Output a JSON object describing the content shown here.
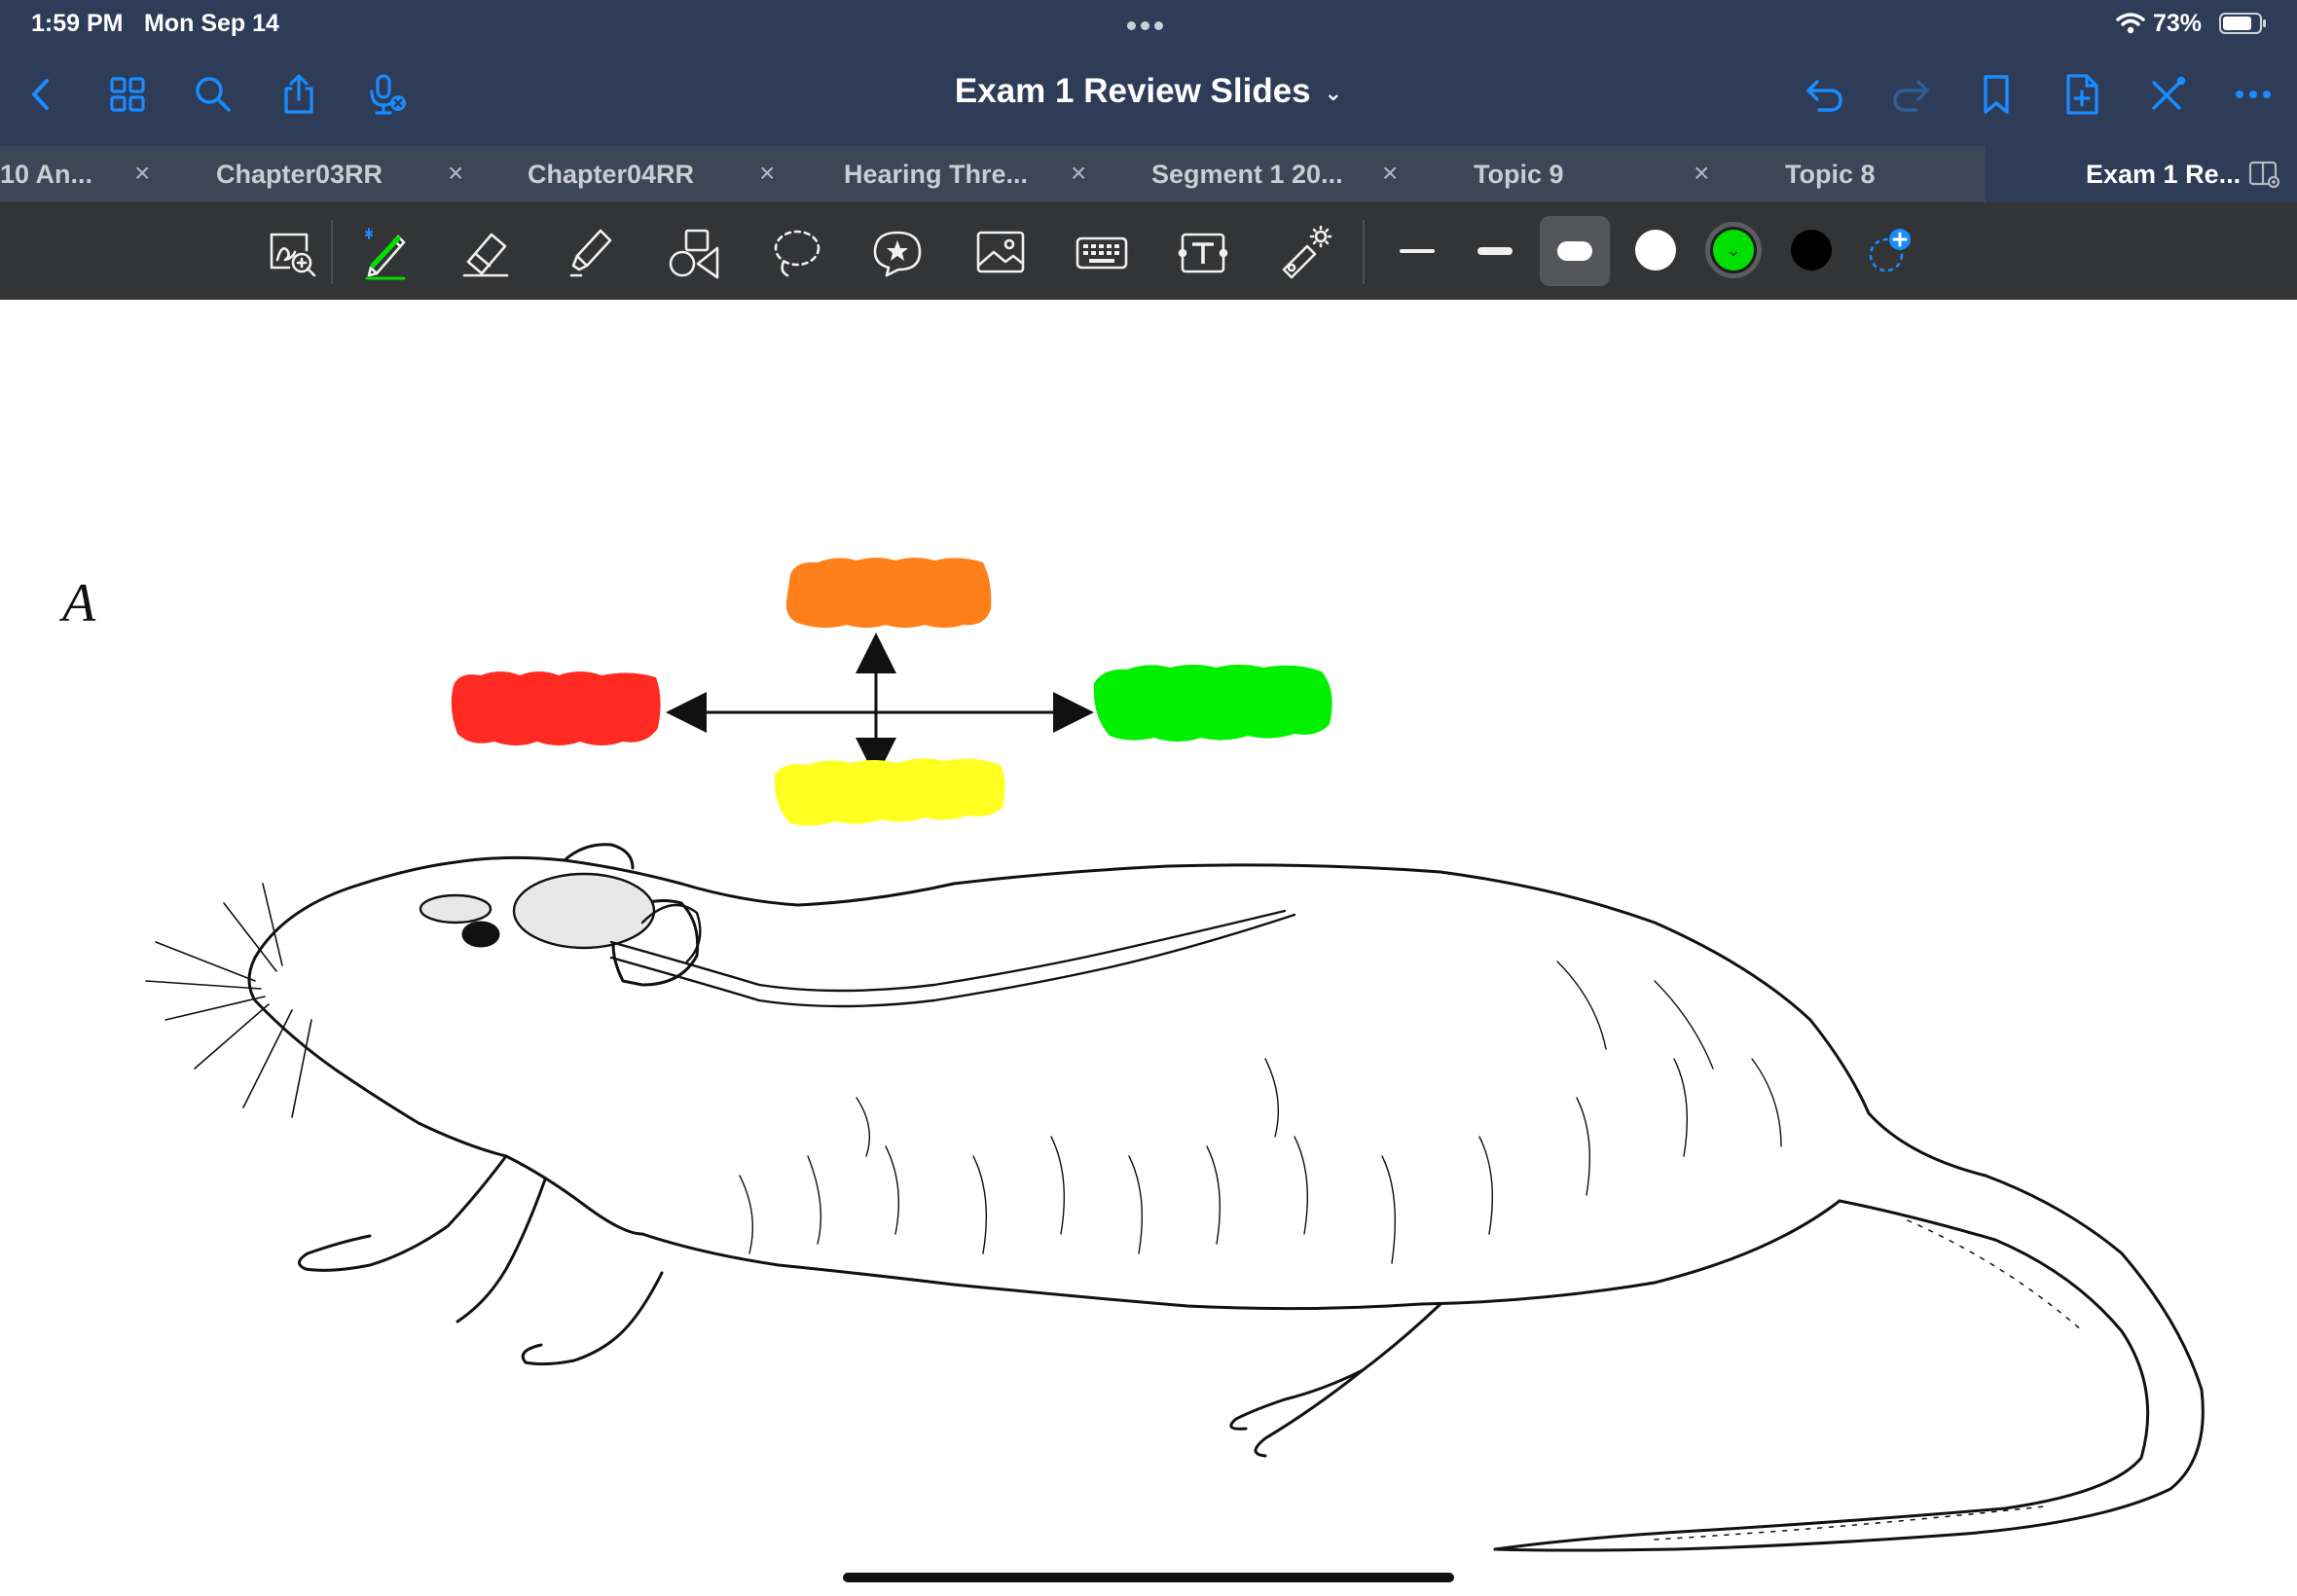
{
  "status": {
    "time": "1:59 PM",
    "date": "Mon Sep 14",
    "battery": "73%"
  },
  "nav": {
    "title": "Exam 1 Review Slides",
    "left_icons": [
      "back-chevron-icon",
      "grid-icon",
      "search-icon",
      "share-icon",
      "mic-icon"
    ],
    "right_icons": [
      "undo-icon",
      "redo-icon",
      "bookmark-icon",
      "add-page-icon",
      "close-tools-icon",
      "more-icon"
    ]
  },
  "tabs": [
    {
      "label": "10 An...",
      "active": false
    },
    {
      "label": "Chapter03RR",
      "active": false
    },
    {
      "label": "Chapter04RR",
      "active": false
    },
    {
      "label": "Hearing Thre...",
      "active": false
    },
    {
      "label": "Segment 1 20...",
      "active": false
    },
    {
      "label": "Topic 9",
      "active": false
    },
    {
      "label": "Topic 8",
      "active": false
    },
    {
      "label": "Exam 1 Re...",
      "active": true
    }
  ],
  "tab_close_glyph": "×",
  "toolbar": {
    "tools": [
      "zoom-lens-icon",
      "pen-icon",
      "eraser-icon",
      "highlighter-icon",
      "shapes-icon",
      "lasso-icon",
      "sticker-icon",
      "image-icon",
      "keyboard-icon",
      "text-box-icon",
      "laser-pointer-icon"
    ],
    "selected_tool": "pen-icon",
    "stroke_widths": [
      "thin",
      "medium",
      "thick"
    ],
    "selected_width": "thick",
    "colors": [
      "#ffffff",
      "#00e000",
      "#000000"
    ],
    "selected_color": "#00e000"
  },
  "page": {
    "figure_label": "A"
  },
  "colors": {
    "nav_bg": "#2e3c58",
    "tab_bg": "#3d4656",
    "toolbar_bg": "#333436",
    "accent_blue": "#1a8cff",
    "marker_orange": "#ff7f1a",
    "marker_red": "#ff2a22",
    "marker_green": "#00f000",
    "marker_yellow": "#ffff22"
  }
}
